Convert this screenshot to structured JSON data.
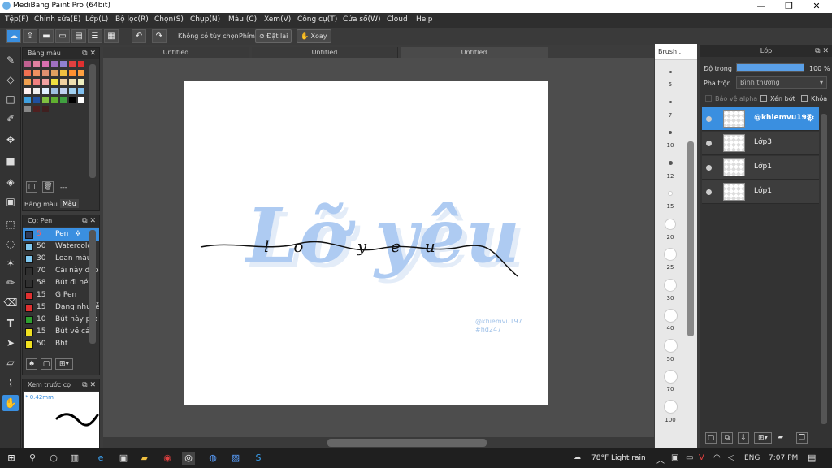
{
  "window": {
    "title": "MediBang Paint Pro (64bit)",
    "min": "—",
    "max": "❐",
    "close": "✕"
  },
  "menu": [
    "Tệp(F)",
    "Chỉnh sửa(E)",
    "Lớp(L)",
    "Bộ lọc(R)",
    "Chọn(S)",
    "Chụp(N)",
    "Màu (C)",
    "Xem(V)",
    "Công cụ(T)",
    "Cửa sổ(W)",
    "Cloud",
    "Help"
  ],
  "toolbar": {
    "option": "Không có tùy chọn",
    "key": "Phím",
    "reset": "Đặt lại",
    "rotate": "Xoay"
  },
  "tabs": [
    "Untitled",
    "Untitled",
    "Untitled"
  ],
  "palette": {
    "title": "Bảng màu",
    "tab1": "Bảng màu",
    "tab2": "Màu",
    "footer": "---",
    "colors": [
      "#c06090",
      "#e080a0",
      "#d870b0",
      "#a070c0",
      "#9080d0",
      "#e04040",
      "#e03030",
      "#f07050",
      "#f09060",
      "#e09070",
      "#e0a060",
      "#f0c040",
      "#ff9030",
      "#ffa040",
      "#f0a050",
      "#f08080",
      "#f0a0a0",
      "#f0e040",
      "#f0d0a0",
      "#f0e0b0",
      "#f0f0c0",
      "#fff0f0",
      "#f0f0f0",
      "#e0f0ff",
      "#a0c0e0",
      "#c0d0f0",
      "#a0d0f0",
      "#80c0f0",
      "#40a0e0",
      "#2050a0",
      "#80c040",
      "#60b030",
      "#40a040",
      "#000000",
      "#ffffff",
      "#888888",
      "#502020",
      "#402020"
    ]
  },
  "brushes": {
    "title": "Cọ: Pen",
    "items": [
      {
        "num": "5",
        "name": "Pen",
        "color": "#2f3b5a"
      },
      {
        "num": "50",
        "name": "Watercolor",
        "color": "#80c8f0"
      },
      {
        "num": "30",
        "name": "Loan màu",
        "color": "#80c8f0"
      },
      {
        "num": "70",
        "name": "Cái này đẹp",
        "color": "#303030"
      },
      {
        "num": "58",
        "name": "Bút đi nét",
        "color": "#303030"
      },
      {
        "num": "15",
        "name": "G Pen",
        "color": "#e03030"
      },
      {
        "num": "15",
        "name": "Dạng nhuyễn",
        "color": "#e03030"
      },
      {
        "num": "10",
        "name": "Bút này pro",
        "color": "#30a030"
      },
      {
        "num": "15",
        "name": "Bút vẽ cá",
        "color": "#f0e020"
      },
      {
        "num": "50",
        "name": "Bht",
        "color": "#f0e020"
      }
    ]
  },
  "preview": {
    "title": "Xem trước cọ",
    "size": "* 0.42mm"
  },
  "sizes": {
    "title": "Brush...",
    "items": [
      "5",
      "7",
      "10",
      "12",
      "15",
      "20",
      "25",
      "30",
      "40",
      "50",
      "70",
      "100"
    ]
  },
  "canvas": {
    "watermark1": "@khiemvu197",
    "watermark2": "#hd247",
    "lettering": "Lỡ yêu",
    "script": "lo yeu"
  },
  "layers": {
    "title": "Lớp",
    "opacity_label": "Độ trong",
    "opacity_value": "100 %",
    "opacity": 1.0,
    "blend_label": "Pha trộn",
    "blend_value": "Bình thường",
    "protect": "Bảo vệ alpha",
    "clip": "Xén bớt",
    "lock": "Khóa",
    "items": [
      {
        "name": "@khiemvu197",
        "selected": true
      },
      {
        "name": "Lớp3"
      },
      {
        "name": "Lớp1"
      },
      {
        "name": "Lớp1"
      }
    ]
  },
  "taskbar": {
    "weather": "78°F  Light rain",
    "lang": "ENG",
    "time": "7:07 PM"
  }
}
